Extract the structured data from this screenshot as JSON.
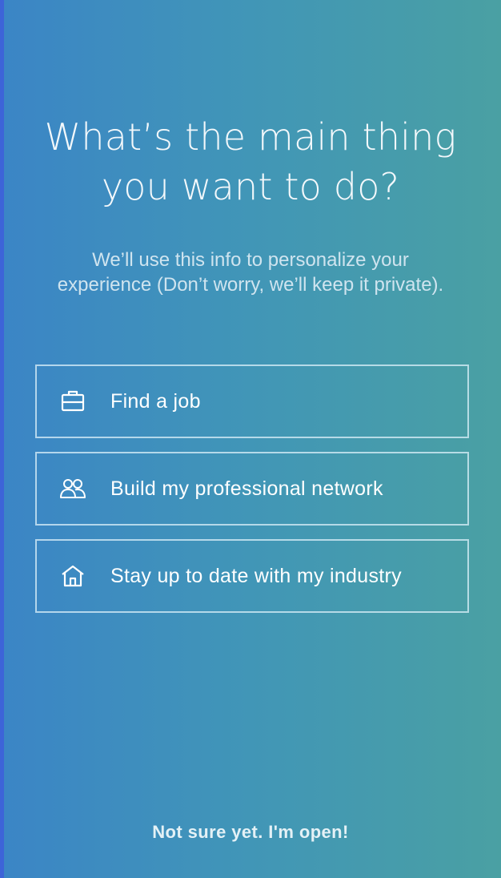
{
  "header": {
    "title_line1": "What’s the main thing",
    "title_line2": "you want to do?",
    "subtitle": "We’ll use this info to personalize your experience (Don’t worry, we’ll keep it private)."
  },
  "options": [
    {
      "label": "Find a job",
      "icon": "briefcase-icon"
    },
    {
      "label": "Build my professional network",
      "icon": "people-icon"
    },
    {
      "label": "Stay up to date with my industry",
      "icon": "home-icon"
    }
  ],
  "footer": {
    "skip_label": "Not sure yet. I'm open!"
  },
  "colors": {
    "gradient_start": "#3b85c6",
    "gradient_end": "#4aa0a3",
    "border": "#dcf0fa",
    "text": "#ffffff"
  }
}
